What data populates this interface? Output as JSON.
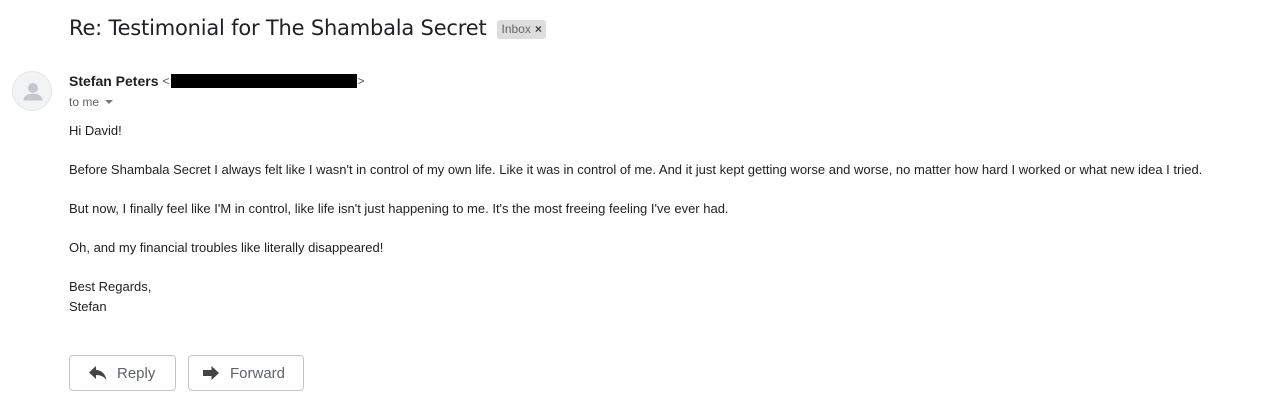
{
  "email": {
    "subject": "Re: Testimonial for The Shambala Secret",
    "label": "Inbox",
    "label_remove": "×",
    "sender_name": "Stefan Peters",
    "email_open": "<",
    "email_close": ">",
    "recipient": "to me",
    "greeting": "Hi David!",
    "paragraphs": [
      "Before Shambala Secret I always felt like I wasn't in control of my own life. Like it was in control of me. And it just kept getting worse and worse, no matter how hard I worked or what new idea I tried.",
      "But now, I finally feel like I'M in control, like life isn't just happening to me. It's the most freeing feeling I've ever had.",
      "Oh, and my financial troubles like literally disappeared!"
    ],
    "signoff": "Best Regards,",
    "signature": "Stefan"
  },
  "actions": {
    "reply_label": "Reply",
    "reply_icon": "reply-arrow-icon",
    "forward_label": "Forward",
    "forward_icon": "forward-arrow-icon"
  },
  "colors": {
    "label_bg": "#dddddd",
    "button_border": "#c6c6c6",
    "secondary_text": "#5f6368"
  }
}
